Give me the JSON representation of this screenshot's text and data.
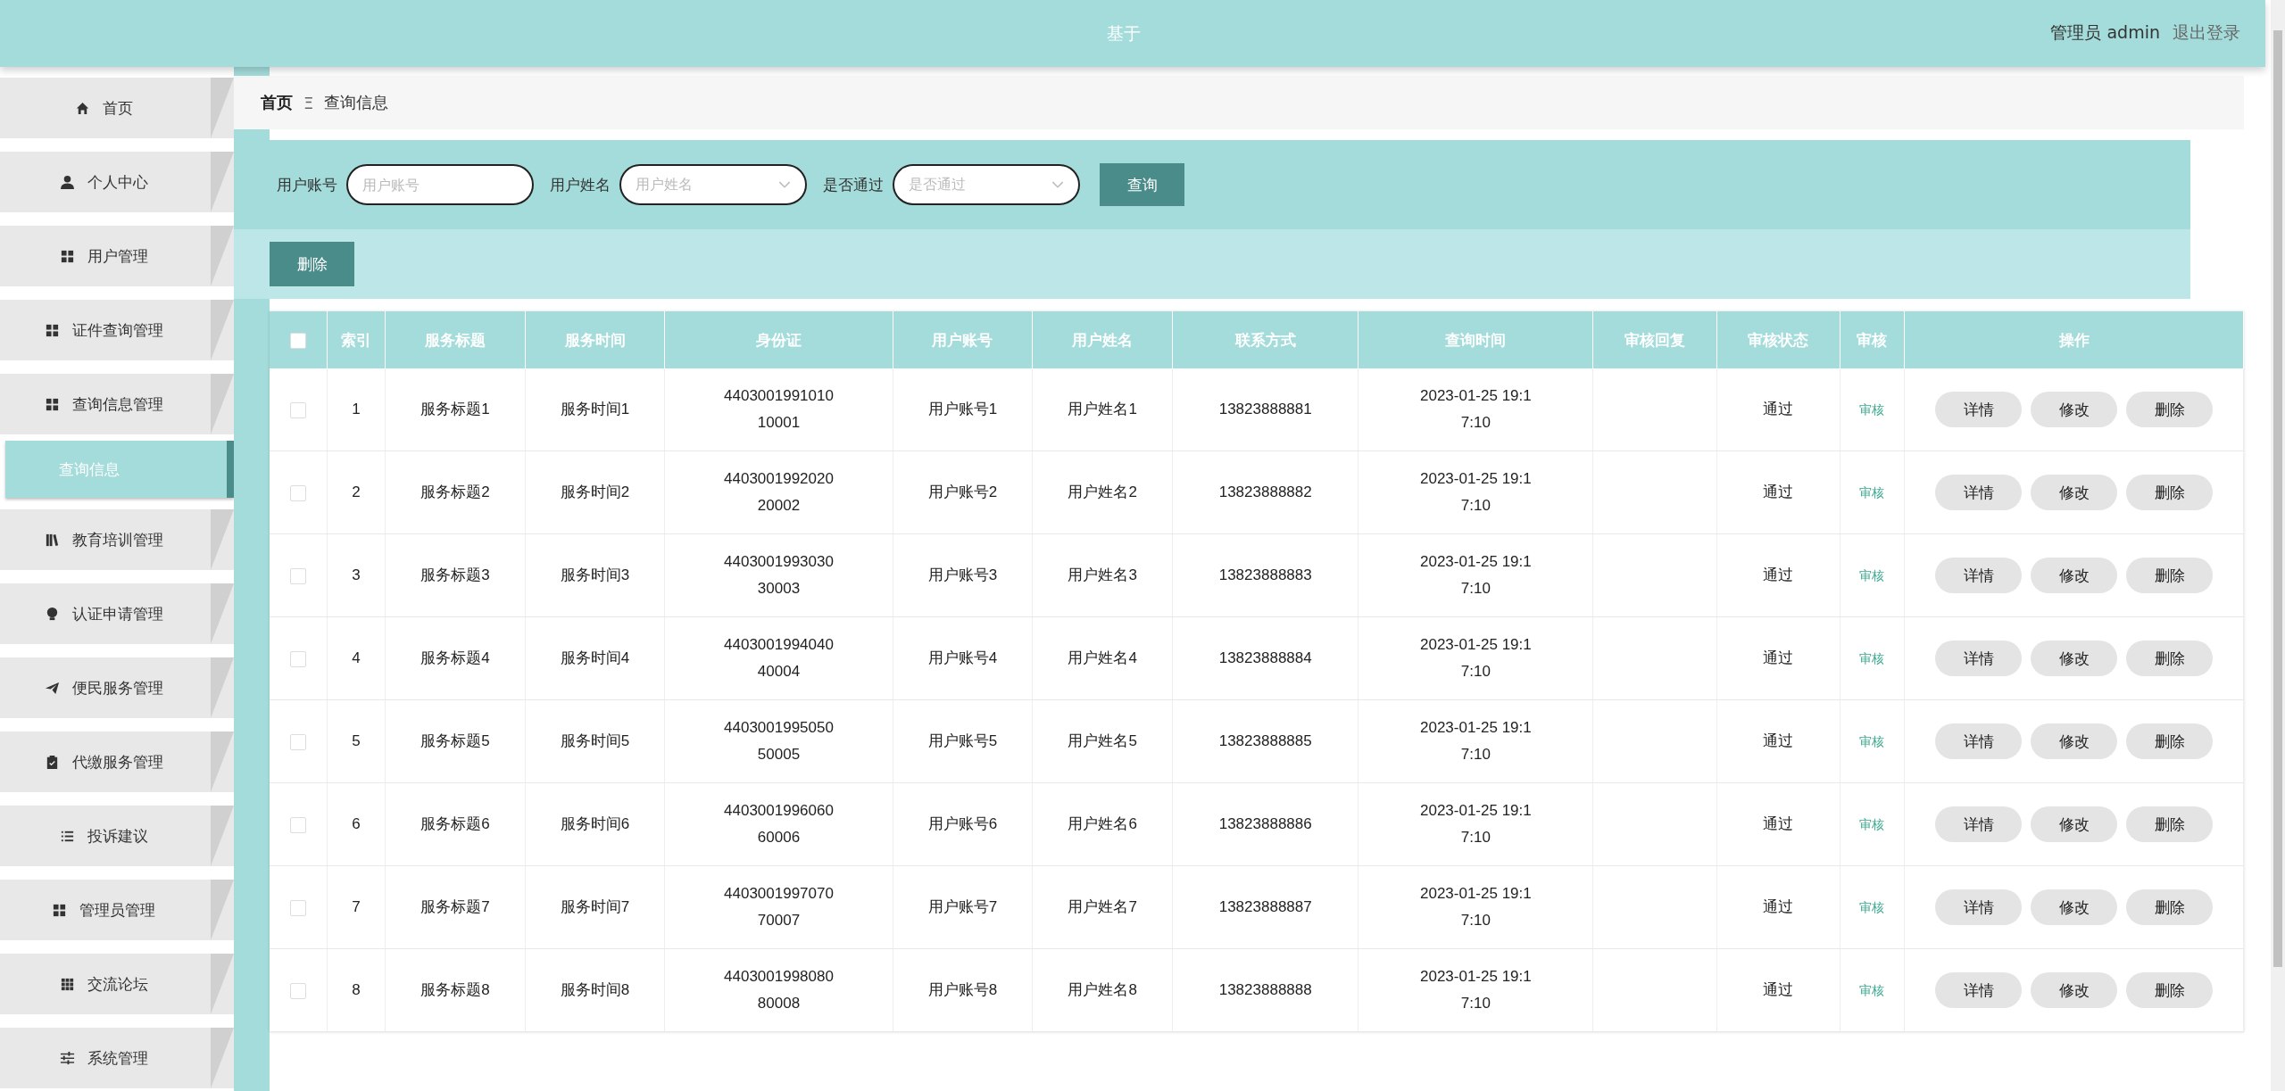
{
  "header": {
    "title": "基于",
    "user": "管理员 admin",
    "logout": "退出登录"
  },
  "sidebar": {
    "items": [
      {
        "label": "首页",
        "selected": false
      },
      {
        "label": "个人中心",
        "selected": false
      },
      {
        "label": "用户管理",
        "selected": false
      },
      {
        "label": "证件查询管理",
        "selected": false
      },
      {
        "label": "查询信息管理",
        "selected": false,
        "children": [
          {
            "label": "查询信息",
            "selected": true
          }
        ]
      },
      {
        "label": "教育培训管理",
        "selected": false
      },
      {
        "label": "认证申请管理",
        "selected": false
      },
      {
        "label": "便民服务管理",
        "selected": false
      },
      {
        "label": "代缴服务管理",
        "selected": false
      },
      {
        "label": "投诉建议",
        "selected": false
      },
      {
        "label": "管理员管理",
        "selected": false
      },
      {
        "label": "交流论坛",
        "selected": false
      },
      {
        "label": "系统管理",
        "selected": false
      }
    ]
  },
  "breadcrumb": {
    "home": "首页",
    "separator": "Ξ",
    "current": "查询信息"
  },
  "search": {
    "fields": [
      {
        "kind": "input",
        "label": "用户账号",
        "placeholder": "用户账号"
      },
      {
        "kind": "select",
        "label": "用户姓名",
        "placeholder": "用户姓名"
      },
      {
        "kind": "select",
        "label": "是否通过",
        "placeholder": "是否通过"
      }
    ],
    "button": "查询"
  },
  "delete_button": "删除",
  "table": {
    "header_checked": false,
    "columns": [
      "索引",
      "服务标题",
      "服务时间",
      "身份证",
      "用户账号",
      "用户姓名",
      "联系方式",
      "查询时间",
      "审核回复",
      "审核状态",
      "审核",
      "操作"
    ],
    "rows": [
      {
        "checked": false,
        "cells": [
          "1",
          "服务标题1",
          "服务时间1",
          "440300199101010001",
          "用户账号1",
          "用户姓名1",
          "13823888881",
          "2023-01-25 19:17:10",
          "",
          "通过"
        ],
        "review": "审核",
        "actions": [
          "详情",
          "修改",
          "删除"
        ]
      },
      {
        "checked": false,
        "cells": [
          "2",
          "服务标题2",
          "服务时间2",
          "440300199202020002",
          "用户账号2",
          "用户姓名2",
          "13823888882",
          "2023-01-25 19:17:10",
          "",
          "通过"
        ],
        "review": "审核",
        "actions": [
          "详情",
          "修改",
          "删除"
        ]
      },
      {
        "checked": false,
        "cells": [
          "3",
          "服务标题3",
          "服务时间3",
          "440300199303030003",
          "用户账号3",
          "用户姓名3",
          "13823888883",
          "2023-01-25 19:17:10",
          "",
          "通过"
        ],
        "review": "审核",
        "actions": [
          "详情",
          "修改",
          "删除"
        ]
      },
      {
        "checked": false,
        "cells": [
          "4",
          "服务标题4",
          "服务时间4",
          "440300199404040004",
          "用户账号4",
          "用户姓名4",
          "13823888884",
          "2023-01-25 19:17:10",
          "",
          "通过"
        ],
        "review": "审核",
        "actions": [
          "详情",
          "修改",
          "删除"
        ]
      },
      {
        "checked": false,
        "cells": [
          "5",
          "服务标题5",
          "服务时间5",
          "440300199505050005",
          "用户账号5",
          "用户姓名5",
          "13823888885",
          "2023-01-25 19:17:10",
          "",
          "通过"
        ],
        "review": "审核",
        "actions": [
          "详情",
          "修改",
          "删除"
        ]
      },
      {
        "checked": false,
        "cells": [
          "6",
          "服务标题6",
          "服务时间6",
          "440300199606060006",
          "用户账号6",
          "用户姓名6",
          "13823888886",
          "2023-01-25 19:17:10",
          "",
          "通过"
        ],
        "review": "审核",
        "actions": [
          "详情",
          "修改",
          "删除"
        ]
      },
      {
        "checked": false,
        "cells": [
          "7",
          "服务标题7",
          "服务时间7",
          "440300199707070007",
          "用户账号7",
          "用户姓名7",
          "13823888887",
          "2023-01-25 19:17:10",
          "",
          "通过"
        ],
        "review": "审核",
        "actions": [
          "详情",
          "修改",
          "删除"
        ]
      },
      {
        "checked": false,
        "cells": [
          "8",
          "服务标题8",
          "服务时间8",
          "440300199808080008",
          "用户账号8",
          "用户姓名8",
          "13823888888",
          "2023-01-25 19:17:10",
          "",
          "通过"
        ],
        "review": "审核",
        "actions": [
          "详情",
          "修改",
          "删除"
        ]
      }
    ]
  }
}
